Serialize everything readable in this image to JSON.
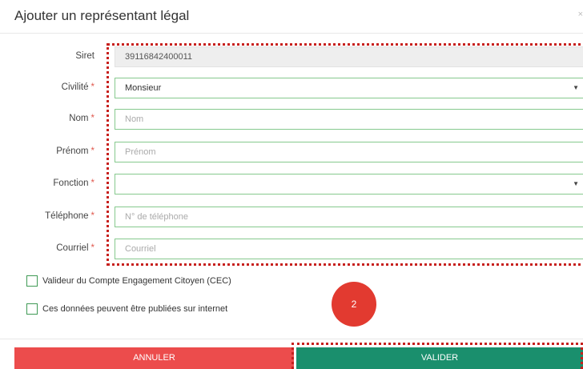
{
  "dialog": {
    "title": "Ajouter un représentant légal",
    "close_symbol": "×"
  },
  "form": {
    "fields": [
      {
        "label": "Siret",
        "required": false,
        "value": "39116842400011",
        "placeholder": ""
      },
      {
        "label": "Civilité",
        "required": true,
        "value": "Monsieur",
        "placeholder": ""
      },
      {
        "label": "Nom",
        "required": true,
        "value": "",
        "placeholder": "Nom"
      },
      {
        "label": "Prénom",
        "required": true,
        "value": "",
        "placeholder": "Prénom"
      },
      {
        "label": "Fonction",
        "required": true,
        "value": "",
        "placeholder": ""
      },
      {
        "label": "Téléphone",
        "required": true,
        "value": "",
        "placeholder": "N° de téléphone"
      },
      {
        "label": "Courriel",
        "required": true,
        "value": "",
        "placeholder": "Courriel"
      }
    ],
    "required_marker": "*",
    "checkboxes": [
      {
        "label": "Valideur du Compte Engagement Citoyen (CEC)",
        "checked": false
      },
      {
        "label": "Ces données peuvent être publiées sur internet",
        "checked": false
      }
    ]
  },
  "annotation": {
    "badge": "2"
  },
  "buttons": {
    "cancel": "ANNULER",
    "validate": "VALIDER"
  },
  "colors": {
    "cancel_bg": "#ec4c4c",
    "validate_bg": "#1a8f6d",
    "field_border": "#86c98e",
    "required_star": "#e05a4f",
    "highlight": "#c7201d"
  }
}
